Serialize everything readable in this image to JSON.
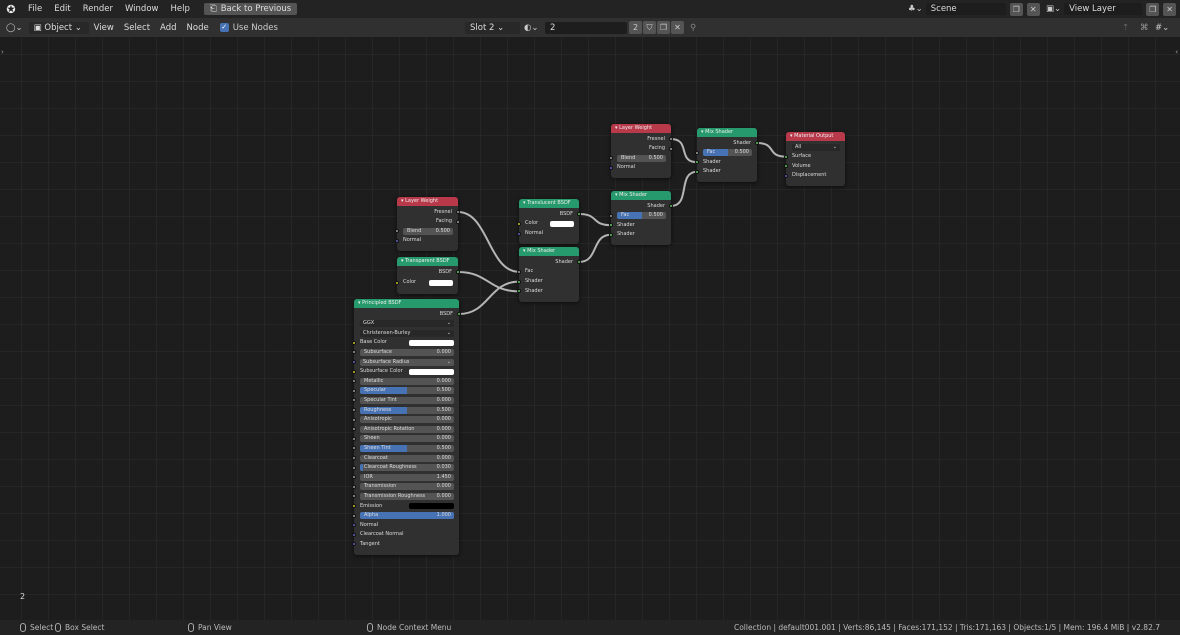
{
  "menubar": {
    "items": [
      "File",
      "Edit",
      "Render",
      "Window",
      "Help"
    ],
    "back_button": "Back to Previous",
    "scene": "Scene",
    "view_layer": "View Layer"
  },
  "header": {
    "mode": "Object",
    "menus": [
      "View",
      "Select",
      "Add",
      "Node"
    ],
    "use_nodes_label": "Use Nodes",
    "use_nodes": true,
    "slot": "Slot 2",
    "material": "2",
    "users": "2"
  },
  "socket_colors": {
    "shader": "#63c763",
    "float": "#a1a1a1",
    "color": "#c7c729",
    "vector": "#6363c7"
  },
  "header_colors": {
    "input": "#b8394a",
    "shader": "#269a6c",
    "output": "#b8394a"
  },
  "nodes": [
    {
      "title": "Layer Weight",
      "kind": "input",
      "rows": [
        {
          "t": "out",
          "label": "Fresnel",
          "s": "float"
        },
        {
          "t": "out",
          "label": "Facing",
          "s": "float"
        },
        {
          "t": "field",
          "label": "Blend",
          "value": "0.500",
          "s": "float",
          "fill": 0
        },
        {
          "t": "in",
          "label": "Normal",
          "s": "vector"
        }
      ]
    },
    {
      "title": "Mix Shader",
      "kind": "shader",
      "rows": [
        {
          "t": "out",
          "label": "Shader",
          "s": "shader"
        },
        {
          "t": "field",
          "label": "Fac",
          "value": "0.500",
          "s": "float",
          "fill": 0.5
        },
        {
          "t": "in",
          "label": "Shader",
          "s": "shader"
        },
        {
          "t": "in",
          "label": "Shader",
          "s": "shader"
        }
      ]
    },
    {
      "title": "Material Output",
      "kind": "output",
      "rows": [
        {
          "t": "dropdown",
          "label": "All"
        },
        {
          "t": "in",
          "label": "Surface",
          "s": "shader"
        },
        {
          "t": "in",
          "label": "Volume",
          "s": "shader"
        },
        {
          "t": "in",
          "label": "Displacement",
          "s": "vector"
        }
      ]
    },
    {
      "title": "Layer Weight",
      "kind": "input",
      "rows": [
        {
          "t": "out",
          "label": "Fresnel",
          "s": "float"
        },
        {
          "t": "out",
          "label": "Facing",
          "s": "float"
        },
        {
          "t": "field",
          "label": "Blend",
          "value": "0.500",
          "s": "float",
          "fill": 0
        },
        {
          "t": "in",
          "label": "Normal",
          "s": "vector"
        }
      ]
    },
    {
      "title": "Translucent BSDF",
      "kind": "shader",
      "rows": [
        {
          "t": "out",
          "label": "BSDF",
          "s": "shader"
        },
        {
          "t": "color",
          "label": "Color",
          "s": "color",
          "value": "#ffffff"
        },
        {
          "t": "in",
          "label": "Normal",
          "s": "vector"
        }
      ]
    },
    {
      "title": "Mix Shader",
      "kind": "shader",
      "rows": [
        {
          "t": "out",
          "label": "Shader",
          "s": "shader"
        },
        {
          "t": "field",
          "label": "Fac",
          "value": "0.500",
          "s": "float",
          "fill": 0.5
        },
        {
          "t": "in",
          "label": "Shader",
          "s": "shader"
        },
        {
          "t": "in",
          "label": "Shader",
          "s": "shader"
        }
      ]
    },
    {
      "title": "Mix Shader",
      "kind": "shader",
      "rows": [
        {
          "t": "out",
          "label": "Shader",
          "s": "shader"
        },
        {
          "t": "in",
          "label": "Fac",
          "s": "float"
        },
        {
          "t": "in",
          "label": "Shader",
          "s": "shader"
        },
        {
          "t": "in",
          "label": "Shader",
          "s": "shader"
        }
      ]
    },
    {
      "title": "Transparent BSDF",
      "kind": "shader",
      "rows": [
        {
          "t": "out",
          "label": "BSDF",
          "s": "shader"
        },
        {
          "t": "color",
          "label": "Color",
          "s": "color",
          "value": "#ffffff"
        }
      ]
    },
    {
      "title": "Principled BSDF",
      "kind": "shader",
      "rows": [
        {
          "t": "out",
          "label": "BSDF",
          "s": "shader"
        },
        {
          "t": "dropdown",
          "label": "GGX"
        },
        {
          "t": "dropdown",
          "label": "Christensen-Burley"
        },
        {
          "t": "color",
          "label": "Base Color",
          "s": "color",
          "value": "#ffffff"
        },
        {
          "t": "field",
          "label": "Subsurface",
          "value": "0.000",
          "s": "float",
          "fill": 0
        },
        {
          "t": "vdrop",
          "label": "Subsurface Radius",
          "s": "vector"
        },
        {
          "t": "color",
          "label": "Subsurface Color",
          "s": "color",
          "value": "#ffffff"
        },
        {
          "t": "field",
          "label": "Metallic",
          "value": "0.000",
          "s": "float",
          "fill": 0
        },
        {
          "t": "field",
          "label": "Specular",
          "value": "0.500",
          "s": "float",
          "fill": 0.5
        },
        {
          "t": "field",
          "label": "Specular Tint",
          "value": "0.000",
          "s": "float",
          "fill": 0
        },
        {
          "t": "field",
          "label": "Roughness",
          "value": "0.500",
          "s": "float",
          "fill": 0.5
        },
        {
          "t": "field",
          "label": "Anisotropic",
          "value": "0.000",
          "s": "float",
          "fill": 0
        },
        {
          "t": "field",
          "label": "Anisotropic Rotation",
          "value": "0.000",
          "s": "float",
          "fill": 0
        },
        {
          "t": "field",
          "label": "Sheen",
          "value": "0.000",
          "s": "float",
          "fill": 0
        },
        {
          "t": "field",
          "label": "Sheen Tint",
          "value": "0.500",
          "s": "float",
          "fill": 0.5
        },
        {
          "t": "field",
          "label": "Clearcoat",
          "value": "0.000",
          "s": "float",
          "fill": 0
        },
        {
          "t": "field",
          "label": "Clearcoat Roughness",
          "value": "0.030",
          "s": "float",
          "fill": 0.03
        },
        {
          "t": "field",
          "label": "IOR",
          "value": "1.450",
          "s": "float",
          "fill": 0
        },
        {
          "t": "field",
          "label": "Transmission",
          "value": "0.000",
          "s": "float",
          "fill": 0
        },
        {
          "t": "field",
          "label": "Transmission Roughness",
          "value": "0.000",
          "s": "float",
          "fill": 0
        },
        {
          "t": "color",
          "label": "Emission",
          "s": "color",
          "value": "#000000"
        },
        {
          "t": "field",
          "label": "Alpha",
          "value": "1.000",
          "s": "float",
          "fill": 1
        },
        {
          "t": "in",
          "label": "Normal",
          "s": "vector"
        },
        {
          "t": "in",
          "label": "Clearcoat Normal",
          "s": "vector"
        },
        {
          "t": "in",
          "label": "Tangent",
          "s": "vector"
        }
      ]
    }
  ],
  "links": [
    {
      "from": [
        3,
        0
      ],
      "to": [
        6,
        1
      ]
    },
    {
      "from": [
        8,
        0
      ],
      "to": [
        6,
        2
      ]
    },
    {
      "from": [
        7,
        0
      ],
      "to": [
        6,
        3
      ]
    },
    {
      "from": [
        6,
        0
      ],
      "to": [
        5,
        3
      ]
    },
    {
      "from": [
        4,
        0
      ],
      "to": [
        5,
        2
      ]
    },
    {
      "from": [
        5,
        0
      ],
      "to": [
        1,
        3
      ]
    },
    {
      "from": [
        0,
        0
      ],
      "to": [
        1,
        2
      ]
    },
    {
      "from": [
        1,
        0
      ],
      "to": [
        2,
        1
      ]
    }
  ],
  "canvas": {
    "corner_label": "2"
  },
  "status": {
    "select": "Select",
    "box_select": "Box Select",
    "pan": "Pan View",
    "context": "Node Context Menu",
    "stats": "Collection | default001.001 | Verts:86,145 | Faces:171,152 | Tris:171,163 | Objects:1/5 | Mem: 196.4 MiB | v2.82.7"
  }
}
